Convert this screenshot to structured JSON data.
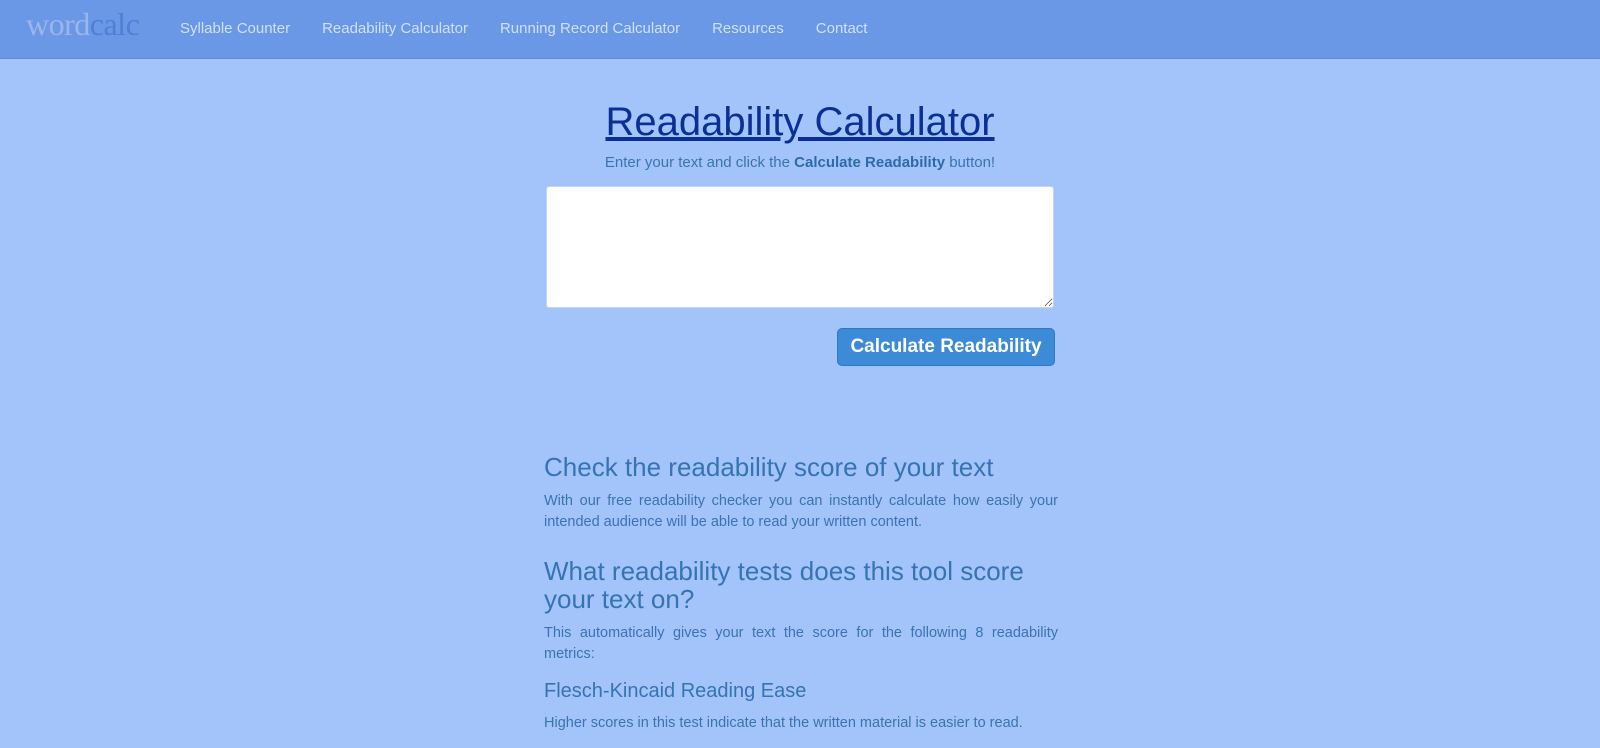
{
  "header": {
    "logo_word": "word",
    "logo_calc": "calc",
    "nav": [
      {
        "label": "Syllable Counter"
      },
      {
        "label": "Readability Calculator"
      },
      {
        "label": "Running Record Calculator"
      },
      {
        "label": "Resources"
      },
      {
        "label": "Contact"
      }
    ]
  },
  "main": {
    "title": "Readability Calculator",
    "intro_prefix": "Enter your text and click the ",
    "intro_bold": "Calculate Readability",
    "intro_suffix": " button!",
    "text_input_value": "",
    "calculate_button": "Calculate Readability"
  },
  "content": {
    "section1_heading": "Check the readability score of your text",
    "section1_text": "With our free readability checker you can instantly calculate how easily your intended audience will be able to read your written content.",
    "section2_heading": "What readability tests does this tool score your text on?",
    "section2_text": "This automatically gives your text the score for the following 8 readability metrics:",
    "metric1_heading": "Flesch-Kincaid Reading Ease",
    "metric1_text": "Higher scores in this test indicate that the written material is easier to read."
  },
  "colors": {
    "page_background": "#a3c4fb",
    "navbar_background": "#6b98e6",
    "button_background": "#3d8ad6",
    "title_link": "#0c2f96"
  }
}
